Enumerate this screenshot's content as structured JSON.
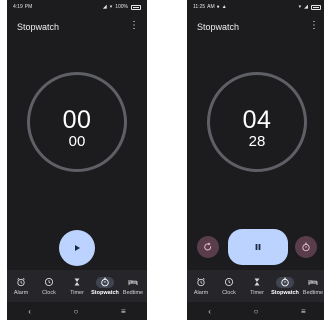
{
  "colors": {
    "background": "#1c1c1f",
    "ring": "#5e6065",
    "accent": "#bcd3ff",
    "secondary_button": "#5a3d4a",
    "nav_bar": "#26262a",
    "nav_active_pill": "#3f4450"
  },
  "screens": [
    {
      "status": {
        "time": "4:19",
        "ampm": "PM",
        "battery": "100%"
      },
      "title": "Stopwatch",
      "timer": {
        "main": "00",
        "sub": "00"
      },
      "state": "stopped",
      "controls": {
        "primary_icon": "play-icon"
      }
    },
    {
      "status": {
        "time": "11:25",
        "ampm": "AM"
      },
      "title": "Stopwatch",
      "timer": {
        "main": "04",
        "sub": "28"
      },
      "state": "running",
      "controls": {
        "primary_icon": "pause-icon",
        "left_icon": "reset-icon",
        "right_icon": "lap-icon"
      }
    }
  ],
  "nav": {
    "items": [
      {
        "label": "Alarm",
        "icon": "alarm-icon"
      },
      {
        "label": "Clock",
        "icon": "clock-icon"
      },
      {
        "label": "Timer",
        "icon": "hourglass-icon"
      },
      {
        "label": "Stopwatch",
        "icon": "stopwatch-icon",
        "active": true
      },
      {
        "label": "Bedtime",
        "icon": "bed-icon"
      }
    ]
  },
  "system_nav": {
    "back": "‹",
    "home": "○",
    "recents": "≡"
  }
}
